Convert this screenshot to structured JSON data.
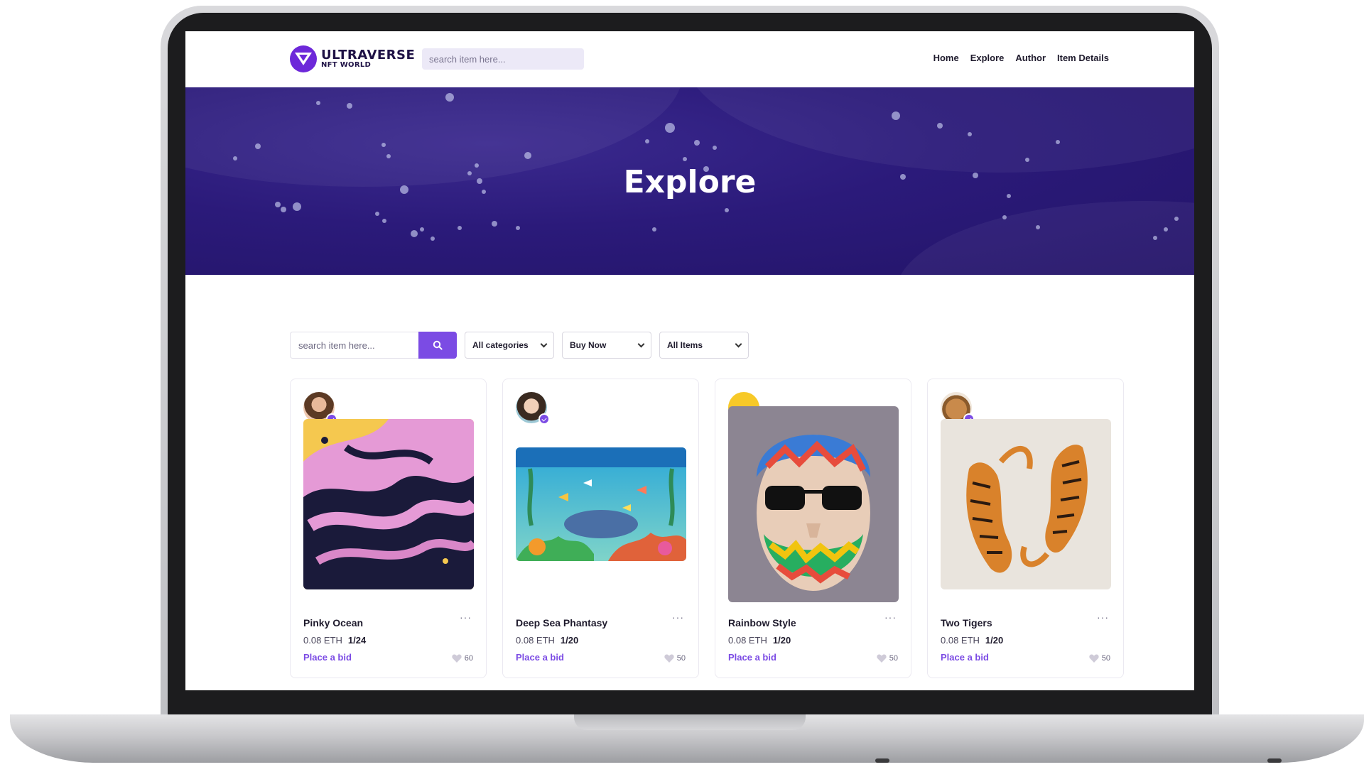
{
  "header": {
    "logo_main": "ULTRAVERSE",
    "logo_sub": "NFT WORLD",
    "search_placeholder": "search item here...",
    "nav": [
      "Home",
      "Explore",
      "Author",
      "Item Details"
    ]
  },
  "hero": {
    "title": "Explore"
  },
  "filters": {
    "search_placeholder": "search item here...",
    "search_icon": "search-icon",
    "category": "All categories",
    "sale_type": "Buy Now",
    "items": "All Items"
  },
  "cards": [
    {
      "title": "Pinky Ocean",
      "price": "0.08 ETH",
      "count": "1/24",
      "bid": "Place a bid",
      "likes": "60",
      "more": "···"
    },
    {
      "title": "Deep Sea Phantasy",
      "price": "0.08 ETH",
      "count": "1/20",
      "bid": "Place a bid",
      "likes": "50",
      "more": "···"
    },
    {
      "title": "Rainbow Style",
      "price": "0.08 ETH",
      "count": "1/20",
      "bid": "Place a bid",
      "likes": "50",
      "more": "···"
    },
    {
      "title": "Two Tigers",
      "price": "0.08 ETH",
      "count": "1/20",
      "bid": "Place a bid",
      "likes": "50",
      "more": "···"
    }
  ],
  "colors": {
    "accent": "#7b4be4",
    "hero": "#2b1a7a",
    "text": "#1f1b2d"
  }
}
